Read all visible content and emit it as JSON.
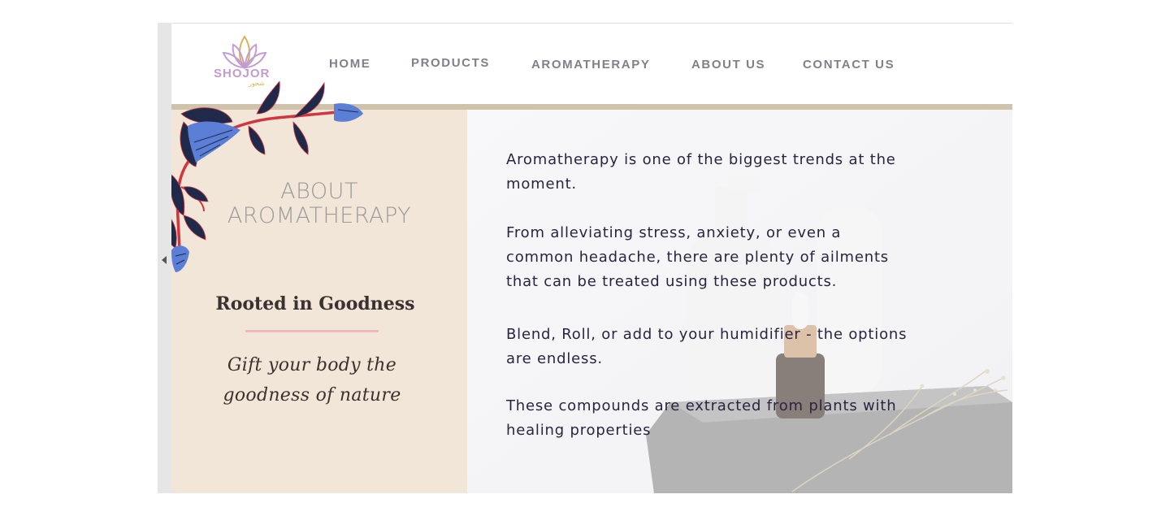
{
  "brand": {
    "name": "SHOJOR",
    "name_arabic": "شجور",
    "colors": {
      "logo_purple": "#c39bd3",
      "logo_gold": "#d6b25a"
    }
  },
  "nav": {
    "items": [
      {
        "label": "HOME"
      },
      {
        "label": "PRODUCTS"
      },
      {
        "label": "AROMATHERAPY"
      },
      {
        "label": "ABOUT US"
      },
      {
        "label": "CONTACT US"
      }
    ]
  },
  "panel": {
    "title_line1": "ABOUT",
    "title_line2": "AROMATHERAPY",
    "heading": "Rooted in Goodness",
    "tagline_line1": "Gift your body the",
    "tagline_line2": "goodness of nature",
    "colors": {
      "background": "#f2e6d8",
      "accent_rule": "#f4b6bd"
    }
  },
  "content": {
    "paragraphs": [
      "Aromatherapy is one of the biggest trends at the moment.",
      "From alleviating stress, anxiety, or even a common headache, there are plenty of ailments that can be treated using these products.",
      "Blend, Roll, or add to your humidifier - the options are endless.",
      "These compounds are extracted from plants with healing properties"
    ]
  },
  "decor": {
    "vine_icon": "floral-vine-icon",
    "colors": {
      "leaf_dark": "#1f2a4a",
      "flower_blue": "#5b7fd6",
      "stem_red": "#d1363f"
    }
  }
}
